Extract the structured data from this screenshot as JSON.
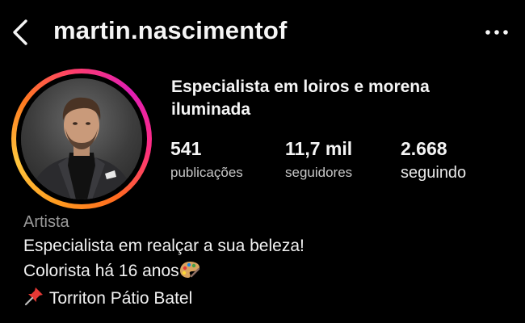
{
  "header": {
    "username": "martin.nascimentof"
  },
  "profile": {
    "display_name": "Especialista em loiros e morena iluminada",
    "stats": [
      {
        "value": "541",
        "label": "publicações"
      },
      {
        "value": "11,7 mil",
        "label": "seguidores"
      },
      {
        "value": "2.668",
        "label": "seguindo"
      }
    ],
    "ring_colors": [
      "#ff9a1f",
      "#e01eb4"
    ]
  },
  "bio": {
    "category": "Artista",
    "line1": "Especialista em realçar a sua beleza!",
    "line2": "Colorista há 16 anos",
    "line2_emoji": "palette-icon",
    "line3": "Torriton Pátio Batel",
    "line3_emoji": "pushpin-icon"
  }
}
